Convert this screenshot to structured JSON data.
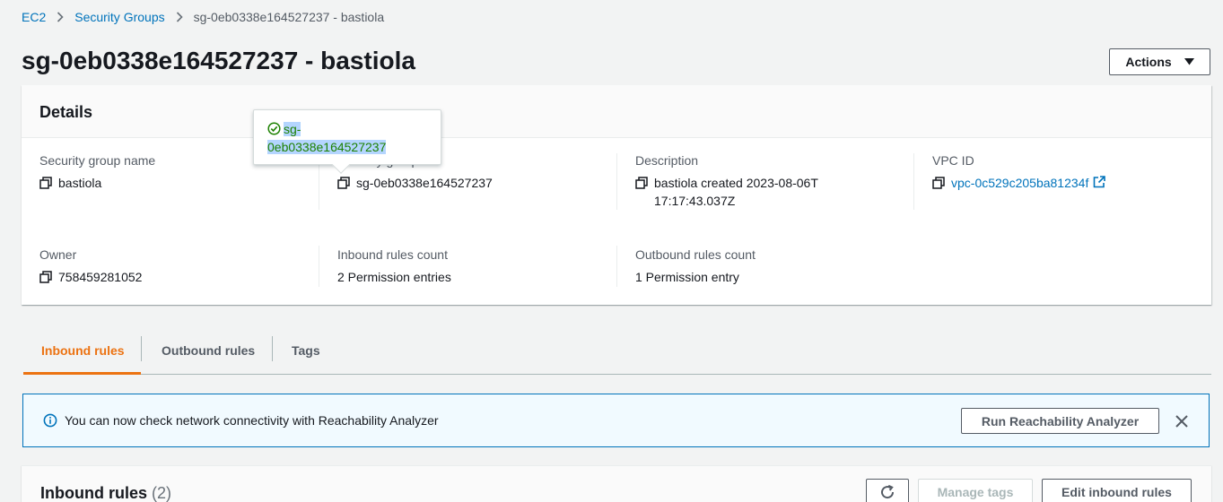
{
  "breadcrumb": {
    "items": [
      "EC2",
      "Security Groups"
    ],
    "current": "sg-0eb0338e164527237 - bastiola"
  },
  "page": {
    "title": "sg-0eb0338e164527237 - bastiola",
    "actions_label": "Actions"
  },
  "details": {
    "title": "Details",
    "fields": {
      "sg_name": {
        "label": "Security group name",
        "value": "bastiola"
      },
      "sg_id": {
        "label": "Security group ID",
        "value": "sg-0eb0338e164527237"
      },
      "description": {
        "label": "Description",
        "value": "bastiola created 2023-08-06T17:17:43.037Z"
      },
      "vpc_id": {
        "label": "VPC ID",
        "value": "vpc-0c529c205ba81234f"
      },
      "owner": {
        "label": "Owner",
        "value": "758459281052"
      },
      "inbound_count": {
        "label": "Inbound rules count",
        "value": "2 Permission entries"
      },
      "outbound_count": {
        "label": "Outbound rules count",
        "value": "1 Permission entry"
      }
    }
  },
  "tooltip": {
    "line1": "sg-",
    "line2": "0eb0338e164527237"
  },
  "tabs": [
    {
      "label": "Inbound rules",
      "active": true
    },
    {
      "label": "Outbound rules",
      "active": false
    },
    {
      "label": "Tags",
      "active": false
    }
  ],
  "banner": {
    "message": "You can now check network connectivity with Reachability Analyzer",
    "button_label": "Run Reachability Analyzer"
  },
  "inbound_rules": {
    "title": "Inbound rules",
    "count": "(2)",
    "manage_tags_label": "Manage tags",
    "edit_label": "Edit inbound rules"
  },
  "colors": {
    "link": "#0073bb",
    "active_tab": "#ec7211",
    "success": "#1d8102",
    "banner_bg": "#f1faff"
  },
  "icons": [
    "chevron-right-icon",
    "caret-down-icon",
    "copy-icon",
    "external-link-icon",
    "check-circle-icon",
    "info-icon",
    "close-icon",
    "refresh-icon"
  ]
}
